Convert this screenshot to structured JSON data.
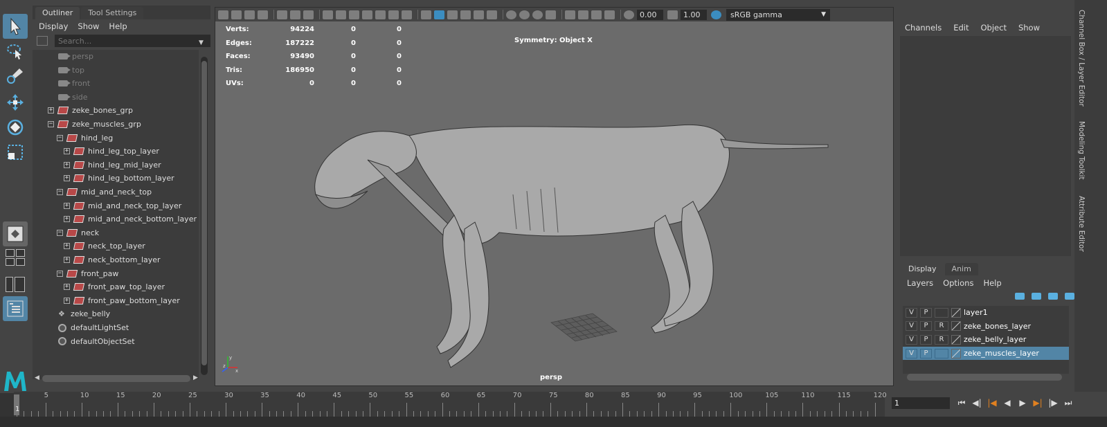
{
  "outliner": {
    "tabs": [
      "Outliner",
      "Tool Settings"
    ],
    "menu": [
      "Display",
      "Show",
      "Help"
    ],
    "search_placeholder": "Search...",
    "items": [
      {
        "label": "persp",
        "depth": 0,
        "icon": "camera-icon",
        "dim": true
      },
      {
        "label": "top",
        "depth": 0,
        "icon": "camera-icon",
        "dim": true
      },
      {
        "label": "front",
        "depth": 0,
        "icon": "camera-icon",
        "dim": true
      },
      {
        "label": "side",
        "depth": 0,
        "icon": "camera-icon",
        "dim": true
      },
      {
        "label": "zeke_bones_grp",
        "depth": 0,
        "icon": "group-icon",
        "expander": "+"
      },
      {
        "label": "zeke_muscles_grp",
        "depth": 0,
        "icon": "group-icon",
        "expander": "-"
      },
      {
        "label": "hind_leg",
        "depth": 1,
        "icon": "group-icon",
        "expander": "-"
      },
      {
        "label": "hind_leg_top_layer",
        "depth": 2,
        "icon": "group-icon",
        "expander": "+"
      },
      {
        "label": "hind_leg_mid_layer",
        "depth": 2,
        "icon": "group-icon",
        "expander": "+"
      },
      {
        "label": "hind_leg_bottom_layer",
        "depth": 2,
        "icon": "group-icon",
        "expander": "+"
      },
      {
        "label": "mid_and_neck_top",
        "depth": 1,
        "icon": "group-icon",
        "expander": "-"
      },
      {
        "label": "mid_and_neck_top_layer",
        "depth": 2,
        "icon": "group-icon",
        "expander": "+"
      },
      {
        "label": "mid_and_neck_bottom_layer",
        "depth": 2,
        "icon": "group-icon",
        "expander": "+"
      },
      {
        "label": "neck",
        "depth": 1,
        "icon": "group-icon",
        "expander": "-"
      },
      {
        "label": "neck_top_layer",
        "depth": 2,
        "icon": "group-icon",
        "expander": "+"
      },
      {
        "label": "neck_bottom_layer",
        "depth": 2,
        "icon": "group-icon",
        "expander": "+"
      },
      {
        "label": "front_paw",
        "depth": 1,
        "icon": "group-icon",
        "expander": "-"
      },
      {
        "label": "front_paw_top_layer",
        "depth": 2,
        "icon": "group-icon",
        "expander": "+"
      },
      {
        "label": "front_paw_bottom_layer",
        "depth": 2,
        "icon": "group-icon",
        "expander": "+"
      },
      {
        "label": "zeke_belly",
        "depth": 0,
        "icon": "mesh-icon"
      },
      {
        "label": "defaultLightSet",
        "depth": 0,
        "icon": "set-icon"
      },
      {
        "label": "defaultObjectSet",
        "depth": 0,
        "icon": "set-icon"
      }
    ]
  },
  "viewport": {
    "fields": {
      "value_a": "0.00",
      "value_b": "1.00",
      "color_space": "sRGB gamma"
    },
    "hud": [
      {
        "label": "Verts:",
        "v1": "94224",
        "v2": "0",
        "v3": "0"
      },
      {
        "label": "Edges:",
        "v1": "187222",
        "v2": "0",
        "v3": "0"
      },
      {
        "label": "Faces:",
        "v1": "93490",
        "v2": "0",
        "v3": "0"
      },
      {
        "label": "Tris:",
        "v1": "186950",
        "v2": "0",
        "v3": "0"
      },
      {
        "label": "UVs:",
        "v1": "0",
        "v2": "0",
        "v3": "0"
      }
    ],
    "symmetry": "Symmetry: Object X",
    "camera": "persp",
    "axes": {
      "x": "x",
      "y": "y",
      "z": "z"
    }
  },
  "channel_box": {
    "menu": [
      "Channels",
      "Edit",
      "Object",
      "Show"
    ]
  },
  "layer_editor": {
    "tabs": [
      "Display",
      "Anim"
    ],
    "menu": [
      "Layers",
      "Options",
      "Help"
    ],
    "layers": [
      {
        "v": "V",
        "p": "P",
        "r": "",
        "name": "layer1",
        "selected": false
      },
      {
        "v": "V",
        "p": "P",
        "r": "R",
        "name": "zeke_bones_layer",
        "selected": false
      },
      {
        "v": "V",
        "p": "P",
        "r": "R",
        "name": "zeke_belly_layer",
        "selected": false
      },
      {
        "v": "V",
        "p": "P",
        "r": "",
        "name": "zeke_muscles_layer",
        "selected": true
      }
    ]
  },
  "side_tabs": [
    "Channel Box / Layer Editor",
    "Modeling Toolkit",
    "Attribute Editor"
  ],
  "timeline": {
    "ticks": [
      "5",
      "10",
      "15",
      "20",
      "25",
      "30",
      "35",
      "40",
      "45",
      "50",
      "55",
      "60",
      "65",
      "70",
      "75",
      "80",
      "85",
      "90",
      "95",
      "100",
      "105",
      "110",
      "115",
      "120"
    ],
    "current_frame_label": "1",
    "frame_field": "1"
  },
  "colors": {
    "accent": "#5285a6",
    "viewport_bg": "#6b6b6b",
    "panel_bg": "#444444"
  }
}
